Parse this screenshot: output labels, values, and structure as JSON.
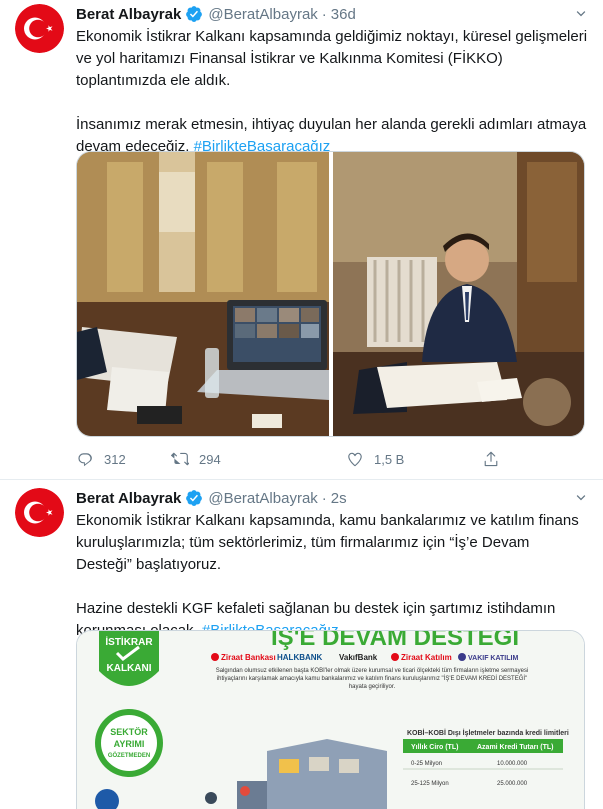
{
  "tweets": [
    {
      "name": "Berat Albayrak",
      "handle": "@BeratAlbayrak",
      "separator": "·",
      "time": "36d",
      "text_part1": "Ekonomik İstikrar Kalkanı kapsamında geldiğimiz noktayı, küresel gelişmeleri ve yol haritamızı Finansal İstikrar ve Kalkınma Komitesi (FİKKO) toplantımızda ele aldık.\n\nİnsanımız merak etmesin, ihtiyaç duyulan her alanda gerekli adımları atmaya devam edeceğiz. ",
      "hashtag": "#BirlikteBaşaracağız",
      "replies": "312",
      "retweets": "294",
      "likes": "1,5 B"
    },
    {
      "name": "Berat Albayrak",
      "handle": "@BeratAlbayrak",
      "separator": "·",
      "time": "2s",
      "text_part1": "Ekonomik İstikrar Kalkanı kapsamında, kamu bankalarımız ve katılım finans kuruluşlarımızla; tüm sektörlerimiz, tüm firmalarımız için “İş’e Devam Desteği” başlatıyoruz.\n\nHazine destekli KGF kefaleti sağlanan bu destek için şartımız istihdamın korunması olacak. ",
      "hashtag": "#BirlikteBaşaracağız",
      "infographic": {
        "title": "İŞ'E DEVAM DESTEĞİ",
        "badge_top": "İSTİKRAR",
        "badge_bottom": "KALKANI",
        "seal_line1": "SEKTÖR",
        "seal_line2": "AYRIMI",
        "seal_line3": "GÖZETMEDEN",
        "banks": [
          "Ziraat Bankası",
          "HALKBANK",
          "VakıfBank",
          "Ziraat Katılım",
          "VAKIF KATILIM"
        ],
        "intro_text": "Salgından olumsuz etkilenen başta KOBİ'ler olmak üzere kurumsal ve ticari ölçekteki tüm firmaların işletme sermayesi ihtiyaçlarını karşılamak amacıyla kamu bankalarımız ve katılım finans kuruluşlarımız \"İŞ'E DEVAM KREDİ DESTEĞİ\" hayata geçiriliyor.",
        "table_title": "KOBİ–KOBİ Dışı İşletmeler bazında kredi limitleri",
        "table_headers": [
          "Yıllık Ciro (TL)",
          "Azami Kredi Tutarı (TL)"
        ],
        "table_rows": [
          [
            "0-25 Milyon",
            "10.000.000"
          ],
          [
            "25-125 Milyon",
            "25.000.000"
          ]
        ]
      }
    }
  ],
  "colors": {
    "accent": "#1da1f2",
    "muted": "#657786",
    "turkish_red": "#e30a17",
    "infographic_green": "#3aaa35"
  }
}
